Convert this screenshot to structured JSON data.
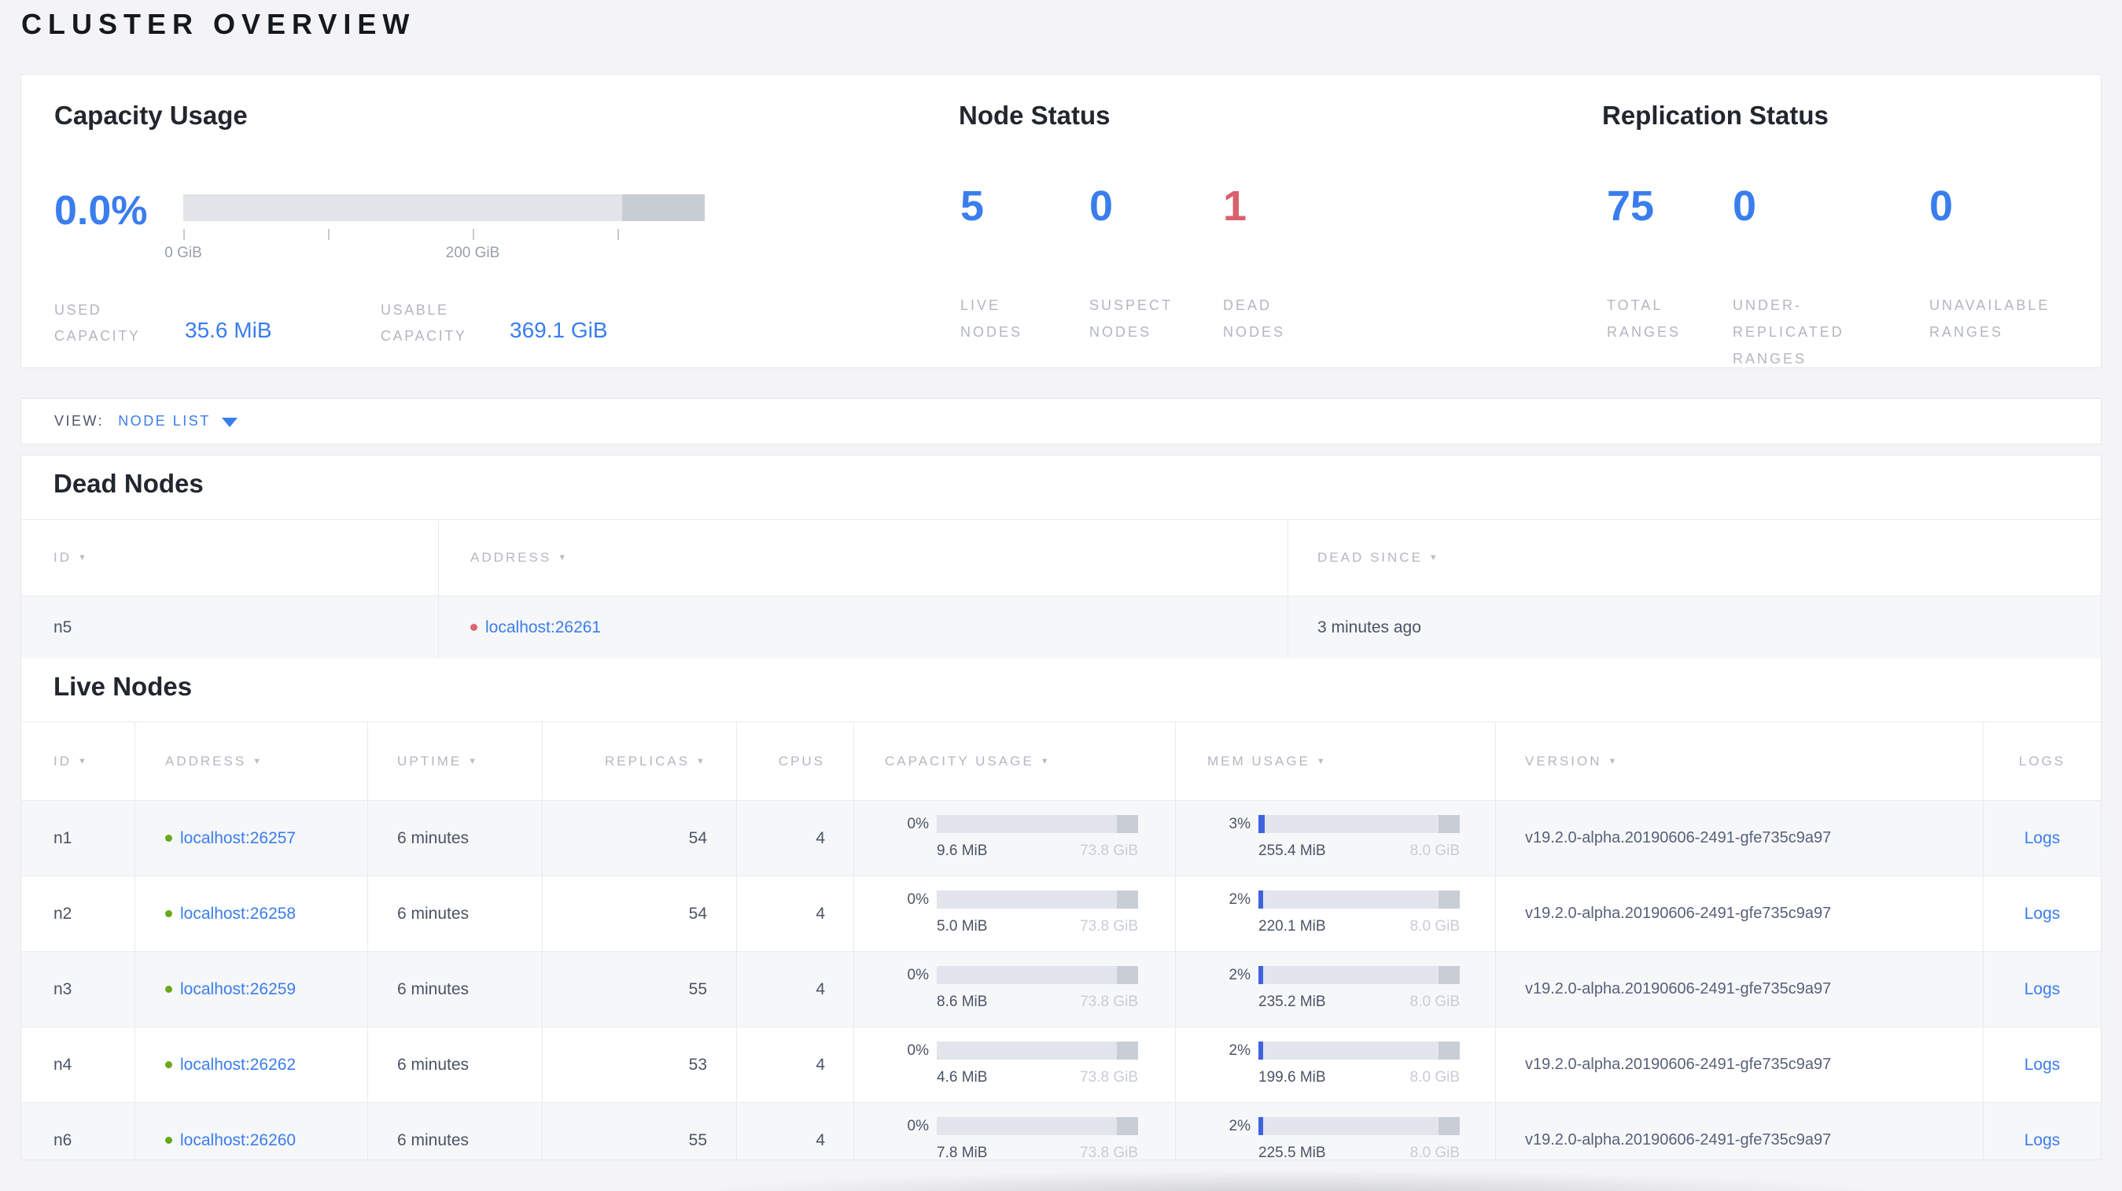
{
  "page": {
    "title": "CLUSTER OVERVIEW"
  },
  "colors": {
    "accent_blue": "#3a7ded",
    "danger_red": "#d9606d",
    "live_green": "#68a91c",
    "mem_fill_blue": "#3f63df"
  },
  "icons": {
    "sort_desc": "▼"
  },
  "summary": {
    "capacity": {
      "title": "Capacity Usage",
      "percent": "0.0%",
      "axis_ticks": [
        "0 GiB",
        "200 GiB"
      ],
      "used_label": "USED CAPACITY",
      "used_value": "35.6 MiB",
      "usable_label": "USABLE CAPACITY",
      "usable_value": "369.1 GiB"
    },
    "node_status": {
      "title": "Node Status",
      "stats": [
        {
          "value": "5",
          "label": "LIVE NODES"
        },
        {
          "value": "0",
          "label": "SUSPECT NODES"
        },
        {
          "value": "1",
          "label": "DEAD NODES"
        }
      ]
    },
    "replication": {
      "title": "Replication Status",
      "stats": [
        {
          "value": "75",
          "label": "TOTAL RANGES"
        },
        {
          "value": "0",
          "label": "UNDER-REPLICATED RANGES"
        },
        {
          "value": "0",
          "label": "UNAVAILABLE RANGES"
        }
      ]
    }
  },
  "view_bar": {
    "label": "VIEW:",
    "selected": "NODE LIST"
  },
  "dead_nodes": {
    "title": "Dead Nodes",
    "columns": [
      {
        "label": "ID"
      },
      {
        "label": "ADDRESS"
      },
      {
        "label": "DEAD SINCE"
      }
    ],
    "rows": [
      {
        "id": "n5",
        "address": "localhost:26261",
        "dead_since": "3 minutes ago"
      }
    ]
  },
  "live_nodes": {
    "title": "Live Nodes",
    "columns": [
      {
        "label": "ID"
      },
      {
        "label": "ADDRESS"
      },
      {
        "label": "UPTIME"
      },
      {
        "label": "REPLICAS"
      },
      {
        "label": "CPUS"
      },
      {
        "label": "CAPACITY USAGE"
      },
      {
        "label": "MEM USAGE"
      },
      {
        "label": "VERSION"
      },
      {
        "label": "LOGS"
      }
    ],
    "rows": [
      {
        "id": "n1",
        "address": "localhost:26257",
        "uptime": "6 minutes",
        "replicas": "54",
        "cpus": "4",
        "capacity": {
          "percent": "0%",
          "percent_value": 0,
          "used": "9.6 MiB",
          "total": "73.8 GiB"
        },
        "memory": {
          "percent": "3%",
          "percent_value": 3,
          "used": "255.4 MiB",
          "total": "8.0 GiB"
        },
        "version": "v19.2.0-alpha.20190606-2491-gfe735c9a97",
        "logs_label": "Logs"
      },
      {
        "id": "n2",
        "address": "localhost:26258",
        "uptime": "6 minutes",
        "replicas": "54",
        "cpus": "4",
        "capacity": {
          "percent": "0%",
          "percent_value": 0,
          "used": "5.0 MiB",
          "total": "73.8 GiB"
        },
        "memory": {
          "percent": "2%",
          "percent_value": 2,
          "used": "220.1 MiB",
          "total": "8.0 GiB"
        },
        "version": "v19.2.0-alpha.20190606-2491-gfe735c9a97",
        "logs_label": "Logs"
      },
      {
        "id": "n3",
        "address": "localhost:26259",
        "uptime": "6 minutes",
        "replicas": "55",
        "cpus": "4",
        "capacity": {
          "percent": "0%",
          "percent_value": 0,
          "used": "8.6 MiB",
          "total": "73.8 GiB"
        },
        "memory": {
          "percent": "2%",
          "percent_value": 2,
          "used": "235.2 MiB",
          "total": "8.0 GiB"
        },
        "version": "v19.2.0-alpha.20190606-2491-gfe735c9a97",
        "logs_label": "Logs"
      },
      {
        "id": "n4",
        "address": "localhost:26262",
        "uptime": "6 minutes",
        "replicas": "53",
        "cpus": "4",
        "capacity": {
          "percent": "0%",
          "percent_value": 0,
          "used": "4.6 MiB",
          "total": "73.8 GiB"
        },
        "memory": {
          "percent": "2%",
          "percent_value": 2,
          "used": "199.6 MiB",
          "total": "8.0 GiB"
        },
        "version": "v19.2.0-alpha.20190606-2491-gfe735c9a97",
        "logs_label": "Logs"
      },
      {
        "id": "n6",
        "address": "localhost:26260",
        "uptime": "6 minutes",
        "replicas": "55",
        "cpus": "4",
        "capacity": {
          "percent": "0%",
          "percent_value": 0,
          "used": "7.8 MiB",
          "total": "73.8 GiB"
        },
        "memory": {
          "percent": "2%",
          "percent_value": 2,
          "used": "225.5 MiB",
          "total": "8.0 GiB"
        },
        "version": "v19.2.0-alpha.20190606-2491-gfe735c9a97",
        "logs_label": "Logs"
      }
    ]
  }
}
